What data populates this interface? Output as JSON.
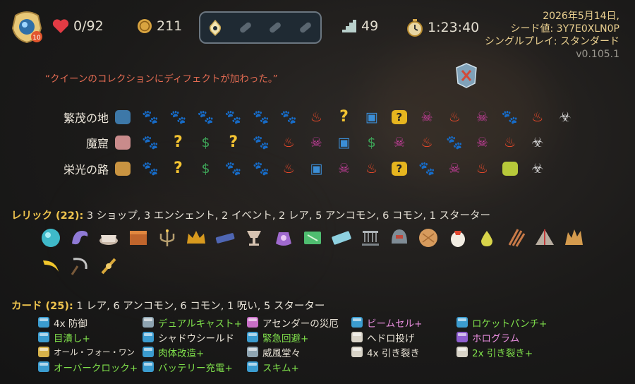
{
  "header": {
    "hp": "0/92",
    "gold": "211",
    "floor": "49",
    "timer": "1:23:40",
    "ascension_badge": "10",
    "date": "2026年5月14日,",
    "seed": "シード値: 3Y7E0XLN0P",
    "mode": "シングルプレイ: スタンダード",
    "version": "v0.105.1"
  },
  "quote": "“クイーンのコレクションにディフェクトが加わった。”",
  "acts": [
    {
      "name": "繁茂の地",
      "nodes": [
        "start-blue",
        "enemy",
        "enemy",
        "enemy",
        "enemy",
        "enemy",
        "enemy",
        "fire",
        "question",
        "chest",
        "question-box",
        "elite",
        "fire",
        "elite",
        "enemy",
        "fire",
        "boss"
      ]
    },
    {
      "name": "魔窟",
      "nodes": [
        "start-pink",
        "enemy",
        "question",
        "shop",
        "question",
        "enemy",
        "fire",
        "elite",
        "chest",
        "shop",
        "elite",
        "fire",
        "enemy",
        "elite",
        "fire",
        "boss"
      ]
    },
    {
      "name": "栄光の路",
      "nodes": [
        "start-gold",
        "enemy",
        "question",
        "shop",
        "enemy",
        "enemy",
        "fire",
        "chest",
        "elite",
        "fire",
        "question-box",
        "enemy",
        "elite",
        "fire",
        "boss-green",
        "boss"
      ]
    }
  ],
  "relics": {
    "label": "レリック (22):",
    "summary": "3 ショップ, 3 エンシェント, 2 イベント, 2 レア, 5 アンコモン, 6 コモン, 1 スターター",
    "items": [
      "orb-relic",
      "serpent-relic",
      "tea-relic",
      "box-relic",
      "candelabra-relic",
      "crown-relic",
      "tray-relic",
      "goblet-relic",
      "pouch-relic",
      "map-relic",
      "ticket-relic",
      "cradle-relic",
      "helmet-relic",
      "cookie-relic",
      "bird-relic",
      "pear-relic",
      "claw-relic",
      "tent-relic",
      "crystal-relic",
      "banana-relic",
      "sickle-relic",
      "vajra-relic"
    ]
  },
  "cards": {
    "label": "カード (25):",
    "summary": "1 レア, 6 アンコモン, 6 コモン, 1 呪い, 5 スターター",
    "columns": [
      [
        {
          "name": "4x 防御",
          "style": "norm",
          "icon": "blue"
        },
        {
          "name": "目潰し+",
          "style": "up",
          "icon": "blue"
        },
        {
          "name": "オール・フォー・ワン",
          "style": "small",
          "icon": "gold"
        },
        {
          "name": "オーバークロック+",
          "style": "up",
          "icon": "blue"
        }
      ],
      [
        {
          "name": "デュアルキャスト+",
          "style": "up",
          "icon": "gray"
        },
        {
          "name": "シャドウシールド",
          "style": "norm",
          "icon": "blue"
        },
        {
          "name": "肉体改造+",
          "style": "up",
          "icon": "blue"
        },
        {
          "name": "バッテリー充電+",
          "style": "up",
          "icon": "blue"
        }
      ],
      [
        {
          "name": "アセンダーの災厄",
          "style": "norm",
          "icon": "pink"
        },
        {
          "name": "緊急回避+",
          "style": "up",
          "icon": "blue"
        },
        {
          "name": "威風堂々",
          "style": "norm",
          "icon": "gray"
        },
        {
          "name": "スキム+",
          "style": "up",
          "icon": "blue"
        }
      ],
      [
        {
          "name": "ビームセル+",
          "style": "pink",
          "icon": "blue"
        },
        {
          "name": "ヘドロ投げ",
          "style": "norm",
          "icon": "white"
        },
        {
          "name": "4x 引き裂き",
          "style": "norm",
          "icon": "white"
        }
      ],
      [
        {
          "name": "ロケットパンチ+",
          "style": "up",
          "icon": "blue"
        },
        {
          "name": "ホログラム",
          "style": "pink",
          "icon": "purple"
        },
        {
          "name": "2x 引き裂き+",
          "style": "up",
          "icon": "white"
        }
      ]
    ]
  }
}
